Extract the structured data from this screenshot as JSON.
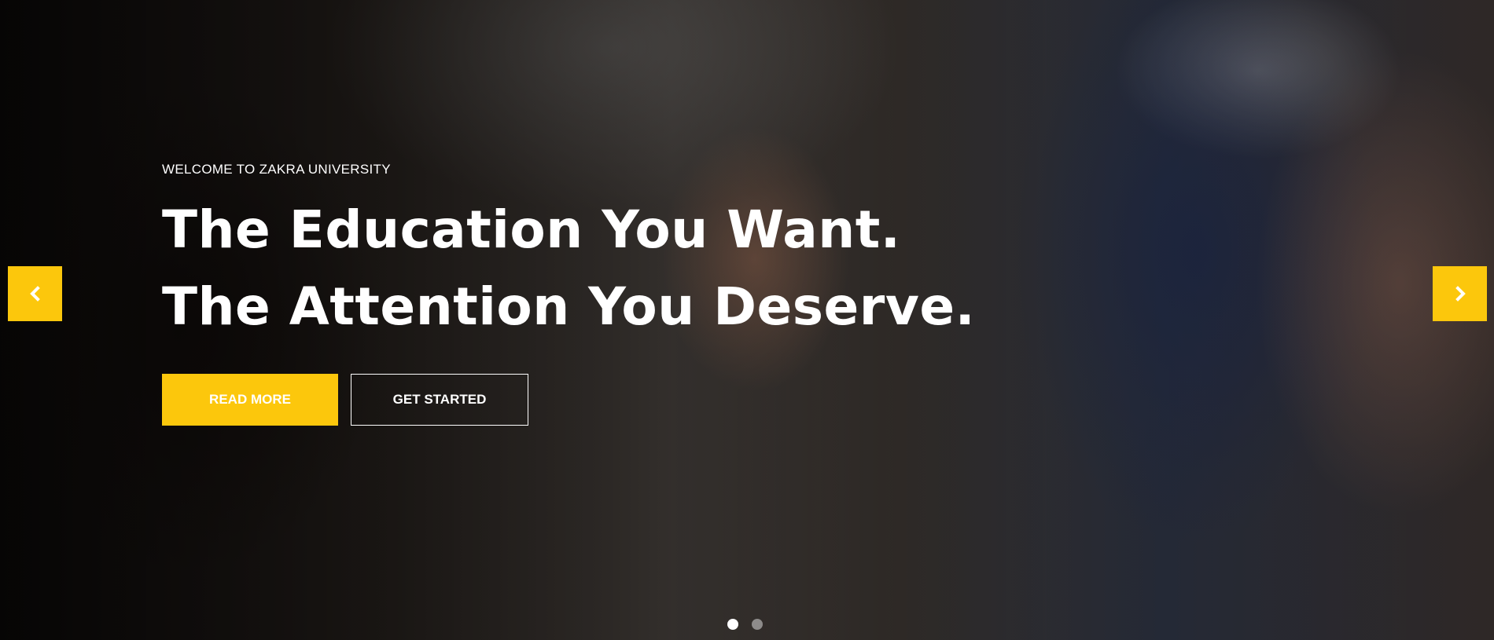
{
  "hero": {
    "eyebrow": "WELCOME TO ZAKRA UNIVERSITY",
    "headline_line1": "The Education You Want.",
    "headline_line2": "The Attention You Deserve.",
    "primary_button": "READ MORE",
    "secondary_button": "GET STARTED"
  },
  "slider": {
    "prev_icon": "chevron-left-icon",
    "next_icon": "chevron-right-icon",
    "slide_count": 2,
    "active_slide": 1
  },
  "colors": {
    "accent": "#fcc70c",
    "text": "#ffffff"
  }
}
